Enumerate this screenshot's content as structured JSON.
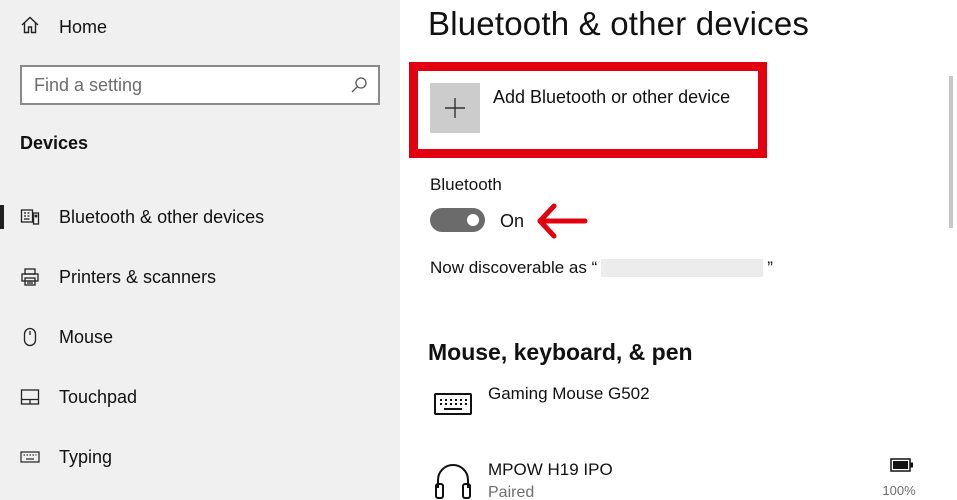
{
  "sidebar": {
    "home_label": "Home",
    "search_placeholder": "Find a setting",
    "section_title": "Devices",
    "items": [
      {
        "label": "Bluetooth & other devices",
        "icon": "bluetooth-devices-icon",
        "selected": true
      },
      {
        "label": "Printers & scanners",
        "icon": "printer-icon",
        "selected": false
      },
      {
        "label": "Mouse",
        "icon": "mouse-icon",
        "selected": false
      },
      {
        "label": "Touchpad",
        "icon": "touchpad-icon",
        "selected": false
      },
      {
        "label": "Typing",
        "icon": "keyboard-icon",
        "selected": false
      }
    ]
  },
  "main": {
    "title": "Bluetooth & other devices",
    "add_device_label": "Add Bluetooth or other device",
    "bluetooth_label": "Bluetooth",
    "bluetooth_state": "On",
    "discoverable_prefix": "Now discoverable as “",
    "discoverable_suffix": "”",
    "section_heading": "Mouse, keyboard, & pen",
    "devices": [
      {
        "name": "Gaming Mouse G502",
        "status": "",
        "icon": "keyboard-device-icon"
      },
      {
        "name": "MPOW H19 IPO",
        "status": "Paired",
        "icon": "headphones-icon",
        "battery": "100%"
      }
    ]
  },
  "colors": {
    "sidebar_bg": "#f0f0f0",
    "annotation_red": "#e3000f",
    "toggle_on": "#6b6b6b",
    "tile_gray": "#cccccc"
  }
}
